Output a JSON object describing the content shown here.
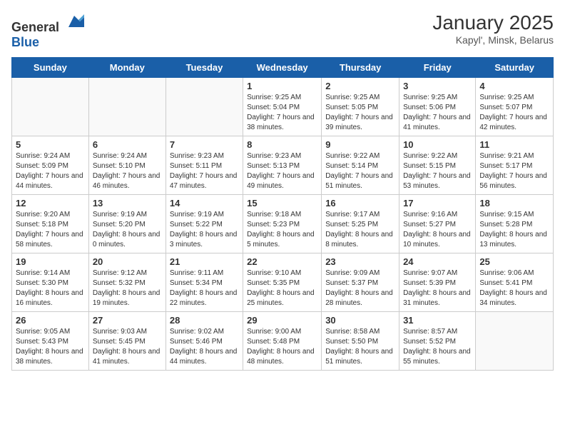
{
  "logo": {
    "general": "General",
    "blue": "Blue"
  },
  "header": {
    "month_year": "January 2025",
    "location": "Kapyl', Minsk, Belarus"
  },
  "weekdays": [
    "Sunday",
    "Monday",
    "Tuesday",
    "Wednesday",
    "Thursday",
    "Friday",
    "Saturday"
  ],
  "weeks": [
    [
      {
        "day": "",
        "sunrise": "",
        "sunset": "",
        "daylight": ""
      },
      {
        "day": "",
        "sunrise": "",
        "sunset": "",
        "daylight": ""
      },
      {
        "day": "",
        "sunrise": "",
        "sunset": "",
        "daylight": ""
      },
      {
        "day": "1",
        "sunrise": "Sunrise: 9:25 AM",
        "sunset": "Sunset: 5:04 PM",
        "daylight": "Daylight: 7 hours and 38 minutes."
      },
      {
        "day": "2",
        "sunrise": "Sunrise: 9:25 AM",
        "sunset": "Sunset: 5:05 PM",
        "daylight": "Daylight: 7 hours and 39 minutes."
      },
      {
        "day": "3",
        "sunrise": "Sunrise: 9:25 AM",
        "sunset": "Sunset: 5:06 PM",
        "daylight": "Daylight: 7 hours and 41 minutes."
      },
      {
        "day": "4",
        "sunrise": "Sunrise: 9:25 AM",
        "sunset": "Sunset: 5:07 PM",
        "daylight": "Daylight: 7 hours and 42 minutes."
      }
    ],
    [
      {
        "day": "5",
        "sunrise": "Sunrise: 9:24 AM",
        "sunset": "Sunset: 5:09 PM",
        "daylight": "Daylight: 7 hours and 44 minutes."
      },
      {
        "day": "6",
        "sunrise": "Sunrise: 9:24 AM",
        "sunset": "Sunset: 5:10 PM",
        "daylight": "Daylight: 7 hours and 46 minutes."
      },
      {
        "day": "7",
        "sunrise": "Sunrise: 9:23 AM",
        "sunset": "Sunset: 5:11 PM",
        "daylight": "Daylight: 7 hours and 47 minutes."
      },
      {
        "day": "8",
        "sunrise": "Sunrise: 9:23 AM",
        "sunset": "Sunset: 5:13 PM",
        "daylight": "Daylight: 7 hours and 49 minutes."
      },
      {
        "day": "9",
        "sunrise": "Sunrise: 9:22 AM",
        "sunset": "Sunset: 5:14 PM",
        "daylight": "Daylight: 7 hours and 51 minutes."
      },
      {
        "day": "10",
        "sunrise": "Sunrise: 9:22 AM",
        "sunset": "Sunset: 5:15 PM",
        "daylight": "Daylight: 7 hours and 53 minutes."
      },
      {
        "day": "11",
        "sunrise": "Sunrise: 9:21 AM",
        "sunset": "Sunset: 5:17 PM",
        "daylight": "Daylight: 7 hours and 56 minutes."
      }
    ],
    [
      {
        "day": "12",
        "sunrise": "Sunrise: 9:20 AM",
        "sunset": "Sunset: 5:18 PM",
        "daylight": "Daylight: 7 hours and 58 minutes."
      },
      {
        "day": "13",
        "sunrise": "Sunrise: 9:19 AM",
        "sunset": "Sunset: 5:20 PM",
        "daylight": "Daylight: 8 hours and 0 minutes."
      },
      {
        "day": "14",
        "sunrise": "Sunrise: 9:19 AM",
        "sunset": "Sunset: 5:22 PM",
        "daylight": "Daylight: 8 hours and 3 minutes."
      },
      {
        "day": "15",
        "sunrise": "Sunrise: 9:18 AM",
        "sunset": "Sunset: 5:23 PM",
        "daylight": "Daylight: 8 hours and 5 minutes."
      },
      {
        "day": "16",
        "sunrise": "Sunrise: 9:17 AM",
        "sunset": "Sunset: 5:25 PM",
        "daylight": "Daylight: 8 hours and 8 minutes."
      },
      {
        "day": "17",
        "sunrise": "Sunrise: 9:16 AM",
        "sunset": "Sunset: 5:27 PM",
        "daylight": "Daylight: 8 hours and 10 minutes."
      },
      {
        "day": "18",
        "sunrise": "Sunrise: 9:15 AM",
        "sunset": "Sunset: 5:28 PM",
        "daylight": "Daylight: 8 hours and 13 minutes."
      }
    ],
    [
      {
        "day": "19",
        "sunrise": "Sunrise: 9:14 AM",
        "sunset": "Sunset: 5:30 PM",
        "daylight": "Daylight: 8 hours and 16 minutes."
      },
      {
        "day": "20",
        "sunrise": "Sunrise: 9:12 AM",
        "sunset": "Sunset: 5:32 PM",
        "daylight": "Daylight: 8 hours and 19 minutes."
      },
      {
        "day": "21",
        "sunrise": "Sunrise: 9:11 AM",
        "sunset": "Sunset: 5:34 PM",
        "daylight": "Daylight: 8 hours and 22 minutes."
      },
      {
        "day": "22",
        "sunrise": "Sunrise: 9:10 AM",
        "sunset": "Sunset: 5:35 PM",
        "daylight": "Daylight: 8 hours and 25 minutes."
      },
      {
        "day": "23",
        "sunrise": "Sunrise: 9:09 AM",
        "sunset": "Sunset: 5:37 PM",
        "daylight": "Daylight: 8 hours and 28 minutes."
      },
      {
        "day": "24",
        "sunrise": "Sunrise: 9:07 AM",
        "sunset": "Sunset: 5:39 PM",
        "daylight": "Daylight: 8 hours and 31 minutes."
      },
      {
        "day": "25",
        "sunrise": "Sunrise: 9:06 AM",
        "sunset": "Sunset: 5:41 PM",
        "daylight": "Daylight: 8 hours and 34 minutes."
      }
    ],
    [
      {
        "day": "26",
        "sunrise": "Sunrise: 9:05 AM",
        "sunset": "Sunset: 5:43 PM",
        "daylight": "Daylight: 8 hours and 38 minutes."
      },
      {
        "day": "27",
        "sunrise": "Sunrise: 9:03 AM",
        "sunset": "Sunset: 5:45 PM",
        "daylight": "Daylight: 8 hours and 41 minutes."
      },
      {
        "day": "28",
        "sunrise": "Sunrise: 9:02 AM",
        "sunset": "Sunset: 5:46 PM",
        "daylight": "Daylight: 8 hours and 44 minutes."
      },
      {
        "day": "29",
        "sunrise": "Sunrise: 9:00 AM",
        "sunset": "Sunset: 5:48 PM",
        "daylight": "Daylight: 8 hours and 48 minutes."
      },
      {
        "day": "30",
        "sunrise": "Sunrise: 8:58 AM",
        "sunset": "Sunset: 5:50 PM",
        "daylight": "Daylight: 8 hours and 51 minutes."
      },
      {
        "day": "31",
        "sunrise": "Sunrise: 8:57 AM",
        "sunset": "Sunset: 5:52 PM",
        "daylight": "Daylight: 8 hours and 55 minutes."
      },
      {
        "day": "",
        "sunrise": "",
        "sunset": "",
        "daylight": ""
      }
    ]
  ]
}
